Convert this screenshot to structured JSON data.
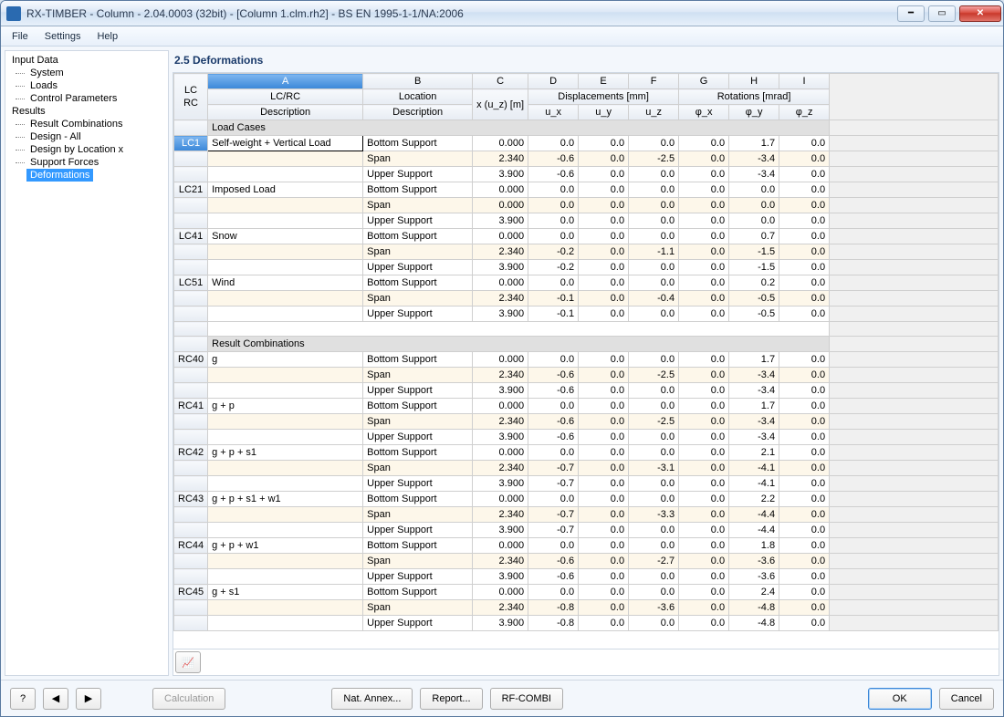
{
  "window": {
    "title": "RX-TIMBER - Column - 2.04.0003 (32bit) - [Column 1.clm.rh2] - BS EN 1995-1-1/NA:2006"
  },
  "menubar": {
    "items": [
      "File",
      "Settings",
      "Help"
    ]
  },
  "tree": {
    "groups": [
      {
        "label": "Input Data",
        "items": [
          "System",
          "Loads",
          "Control Parameters"
        ]
      },
      {
        "label": "Results",
        "items": [
          "Result Combinations",
          "Design - All",
          "Design by Location x",
          "Support Forces",
          "Deformations"
        ],
        "selected": "Deformations"
      }
    ]
  },
  "panel": {
    "title": "2.5 Deformations"
  },
  "headers": {
    "letters": [
      "A",
      "B",
      "C",
      "D",
      "E",
      "F",
      "G",
      "H",
      "I"
    ],
    "lc_rc_top": "LC",
    "lc_rc_bot": "RC",
    "col_A_top": "LC/RC",
    "col_A_bot": "Description",
    "col_B_top": "Location",
    "col_B_bot": "Description",
    "col_C": "x (u_z) [m]",
    "disp_group": "Displacements [mm]",
    "rot_group": "Rotations [mrad]",
    "ux": "u_x",
    "uy": "u_y",
    "uz": "u_z",
    "phix": "φ_x",
    "phiy": "φ_y",
    "phiz": "φ_z"
  },
  "sections": {
    "load_cases": "Load Cases",
    "result_combinations": "Result Combinations"
  },
  "rows": [
    {
      "id": "LC1",
      "sel": true,
      "desc": "Self-weight + Vertical Load",
      "loc": "Bottom Support",
      "x": "0.000",
      "ux": "0.0",
      "uy": "0.0",
      "uz": "0.0",
      "phx": "0.0",
      "phy": "1.7",
      "phz": "0.0"
    },
    {
      "id": "",
      "desc": "",
      "loc": "Span",
      "x": "2.340",
      "ux": "-0.6",
      "uy": "0.0",
      "uz": "-2.5",
      "phx": "0.0",
      "phy": "-3.4",
      "phz": "0.0",
      "alt": true
    },
    {
      "id": "",
      "desc": "",
      "loc": "Upper Support",
      "x": "3.900",
      "ux": "-0.6",
      "uy": "0.0",
      "uz": "0.0",
      "phx": "0.0",
      "phy": "-3.4",
      "phz": "0.0"
    },
    {
      "id": "LC21",
      "desc": "Imposed Load",
      "loc": "Bottom Support",
      "x": "0.000",
      "ux": "0.0",
      "uy": "0.0",
      "uz": "0.0",
      "phx": "0.0",
      "phy": "0.0",
      "phz": "0.0"
    },
    {
      "id": "",
      "desc": "",
      "loc": "Span",
      "x": "0.000",
      "ux": "0.0",
      "uy": "0.0",
      "uz": "0.0",
      "phx": "0.0",
      "phy": "0.0",
      "phz": "0.0",
      "alt": true
    },
    {
      "id": "",
      "desc": "",
      "loc": "Upper Support",
      "x": "3.900",
      "ux": "0.0",
      "uy": "0.0",
      "uz": "0.0",
      "phx": "0.0",
      "phy": "0.0",
      "phz": "0.0"
    },
    {
      "id": "LC41",
      "desc": "Snow",
      "loc": "Bottom Support",
      "x": "0.000",
      "ux": "0.0",
      "uy": "0.0",
      "uz": "0.0",
      "phx": "0.0",
      "phy": "0.7",
      "phz": "0.0"
    },
    {
      "id": "",
      "desc": "",
      "loc": "Span",
      "x": "2.340",
      "ux": "-0.2",
      "uy": "0.0",
      "uz": "-1.1",
      "phx": "0.0",
      "phy": "-1.5",
      "phz": "0.0",
      "alt": true
    },
    {
      "id": "",
      "desc": "",
      "loc": "Upper Support",
      "x": "3.900",
      "ux": "-0.2",
      "uy": "0.0",
      "uz": "0.0",
      "phx": "0.0",
      "phy": "-1.5",
      "phz": "0.0"
    },
    {
      "id": "LC51",
      "desc": "Wind",
      "loc": "Bottom Support",
      "x": "0.000",
      "ux": "0.0",
      "uy": "0.0",
      "uz": "0.0",
      "phx": "0.0",
      "phy": "0.2",
      "phz": "0.0"
    },
    {
      "id": "",
      "desc": "",
      "loc": "Span",
      "x": "2.340",
      "ux": "-0.1",
      "uy": "0.0",
      "uz": "-0.4",
      "phx": "0.0",
      "phy": "-0.5",
      "phz": "0.0",
      "alt": true
    },
    {
      "id": "",
      "desc": "",
      "loc": "Upper Support",
      "x": "3.900",
      "ux": "-0.1",
      "uy": "0.0",
      "uz": "0.0",
      "phx": "0.0",
      "phy": "-0.5",
      "phz": "0.0"
    }
  ],
  "rc_rows": [
    {
      "id": "RC40",
      "desc": "g",
      "loc": "Bottom Support",
      "x": "0.000",
      "ux": "0.0",
      "uy": "0.0",
      "uz": "0.0",
      "phx": "0.0",
      "phy": "1.7",
      "phz": "0.0"
    },
    {
      "id": "",
      "desc": "",
      "loc": "Span",
      "x": "2.340",
      "ux": "-0.6",
      "uy": "0.0",
      "uz": "-2.5",
      "phx": "0.0",
      "phy": "-3.4",
      "phz": "0.0",
      "alt": true
    },
    {
      "id": "",
      "desc": "",
      "loc": "Upper Support",
      "x": "3.900",
      "ux": "-0.6",
      "uy": "0.0",
      "uz": "0.0",
      "phx": "0.0",
      "phy": "-3.4",
      "phz": "0.0"
    },
    {
      "id": "RC41",
      "desc": "g + p",
      "loc": "Bottom Support",
      "x": "0.000",
      "ux": "0.0",
      "uy": "0.0",
      "uz": "0.0",
      "phx": "0.0",
      "phy": "1.7",
      "phz": "0.0"
    },
    {
      "id": "",
      "desc": "",
      "loc": "Span",
      "x": "2.340",
      "ux": "-0.6",
      "uy": "0.0",
      "uz": "-2.5",
      "phx": "0.0",
      "phy": "-3.4",
      "phz": "0.0",
      "alt": true
    },
    {
      "id": "",
      "desc": "",
      "loc": "Upper Support",
      "x": "3.900",
      "ux": "-0.6",
      "uy": "0.0",
      "uz": "0.0",
      "phx": "0.0",
      "phy": "-3.4",
      "phz": "0.0"
    },
    {
      "id": "RC42",
      "desc": "g + p + s1",
      "loc": "Bottom Support",
      "x": "0.000",
      "ux": "0.0",
      "uy": "0.0",
      "uz": "0.0",
      "phx": "0.0",
      "phy": "2.1",
      "phz": "0.0"
    },
    {
      "id": "",
      "desc": "",
      "loc": "Span",
      "x": "2.340",
      "ux": "-0.7",
      "uy": "0.0",
      "uz": "-3.1",
      "phx": "0.0",
      "phy": "-4.1",
      "phz": "0.0",
      "alt": true
    },
    {
      "id": "",
      "desc": "",
      "loc": "Upper Support",
      "x": "3.900",
      "ux": "-0.7",
      "uy": "0.0",
      "uz": "0.0",
      "phx": "0.0",
      "phy": "-4.1",
      "phz": "0.0"
    },
    {
      "id": "RC43",
      "desc": "g + p + s1 + w1",
      "loc": "Bottom Support",
      "x": "0.000",
      "ux": "0.0",
      "uy": "0.0",
      "uz": "0.0",
      "phx": "0.0",
      "phy": "2.2",
      "phz": "0.0"
    },
    {
      "id": "",
      "desc": "",
      "loc": "Span",
      "x": "2.340",
      "ux": "-0.7",
      "uy": "0.0",
      "uz": "-3.3",
      "phx": "0.0",
      "phy": "-4.4",
      "phz": "0.0",
      "alt": true
    },
    {
      "id": "",
      "desc": "",
      "loc": "Upper Support",
      "x": "3.900",
      "ux": "-0.7",
      "uy": "0.0",
      "uz": "0.0",
      "phx": "0.0",
      "phy": "-4.4",
      "phz": "0.0"
    },
    {
      "id": "RC44",
      "desc": "g + p + w1",
      "loc": "Bottom Support",
      "x": "0.000",
      "ux": "0.0",
      "uy": "0.0",
      "uz": "0.0",
      "phx": "0.0",
      "phy": "1.8",
      "phz": "0.0"
    },
    {
      "id": "",
      "desc": "",
      "loc": "Span",
      "x": "2.340",
      "ux": "-0.6",
      "uy": "0.0",
      "uz": "-2.7",
      "phx": "0.0",
      "phy": "-3.6",
      "phz": "0.0",
      "alt": true
    },
    {
      "id": "",
      "desc": "",
      "loc": "Upper Support",
      "x": "3.900",
      "ux": "-0.6",
      "uy": "0.0",
      "uz": "0.0",
      "phx": "0.0",
      "phy": "-3.6",
      "phz": "0.0"
    },
    {
      "id": "RC45",
      "desc": "g + s1",
      "loc": "Bottom Support",
      "x": "0.000",
      "ux": "0.0",
      "uy": "0.0",
      "uz": "0.0",
      "phx": "0.0",
      "phy": "2.4",
      "phz": "0.0"
    },
    {
      "id": "",
      "desc": "",
      "loc": "Span",
      "x": "2.340",
      "ux": "-0.8",
      "uy": "0.0",
      "uz": "-3.6",
      "phx": "0.0",
      "phy": "-4.8",
      "phz": "0.0",
      "alt": true
    },
    {
      "id": "",
      "desc": "",
      "loc": "Upper Support",
      "x": "3.900",
      "ux": "-0.8",
      "uy": "0.0",
      "uz": "0.0",
      "phx": "0.0",
      "phy": "-4.8",
      "phz": "0.0"
    }
  ],
  "footer": {
    "calculation": "Calculation",
    "nat_annex": "Nat. Annex...",
    "report": "Report...",
    "rf_combi": "RF-COMBI",
    "ok": "OK",
    "cancel": "Cancel"
  }
}
